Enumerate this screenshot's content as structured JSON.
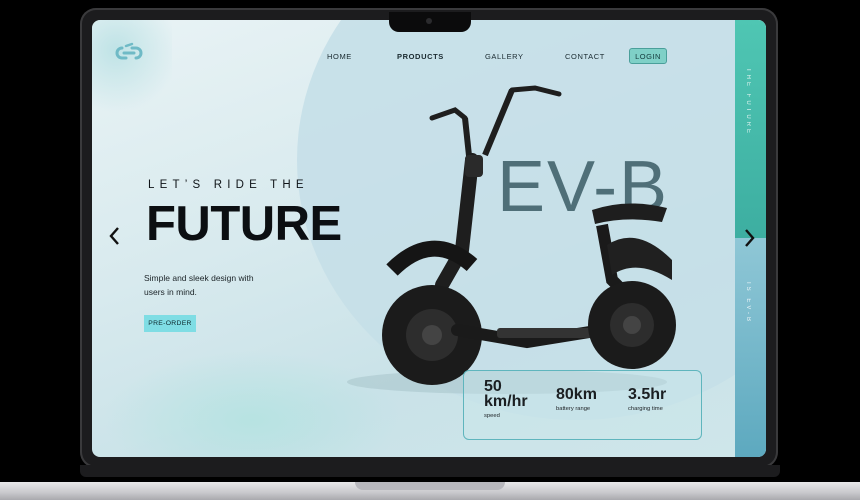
{
  "nav": {
    "home": "HOME",
    "products": "PRODUCTS",
    "gallery": "GALLERY",
    "contact": "CONTACT",
    "login": "LOGIN"
  },
  "hero": {
    "tagline": "LET’S RIDE THE",
    "headline": "FUTURE",
    "description": "Simple and sleek design with users in mind.",
    "cta": "PRE-ORDER",
    "model_name": "EV-B"
  },
  "side": {
    "top_text": "THE FUTURE",
    "bottom_text": "IS EV-B"
  },
  "stats": [
    {
      "value": "50 km/hr",
      "label": "speed"
    },
    {
      "value": "80km",
      "label": "battery range"
    },
    {
      "value": "3.5hr",
      "label": "charging time"
    }
  ],
  "icons": {
    "logo": "link-logo-icon",
    "prev": "chevron-left-icon",
    "next": "chevron-right-icon"
  },
  "colors": {
    "accent": "#4fc6b3",
    "cta": "#7fdde4",
    "model_text": "#4f6f78"
  }
}
